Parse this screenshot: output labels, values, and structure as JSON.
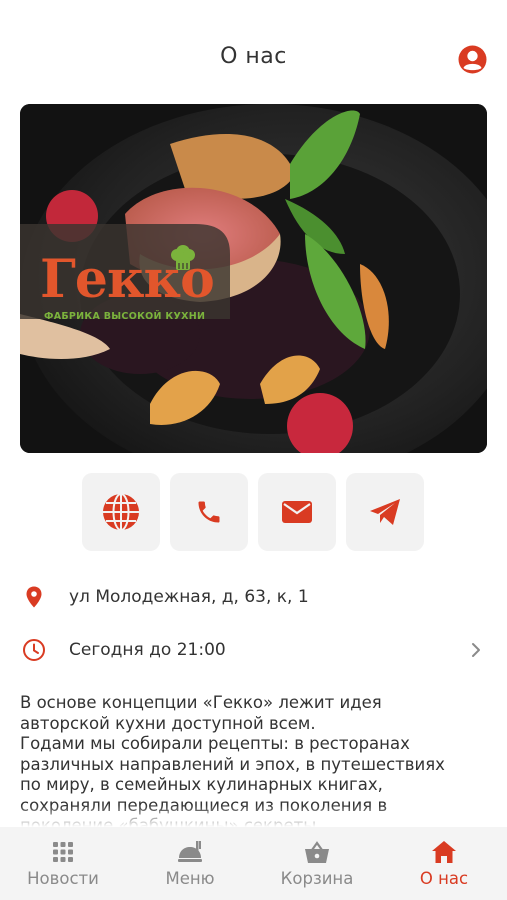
{
  "header": {
    "title": "О нас",
    "profile_icon": "profile-icon"
  },
  "hero": {
    "logo_title": "Гекко",
    "logo_subtitle": "ФАБРИКА ВЫСОКОЙ КУХНИ",
    "chef_hat_icon": "chef-hat-icon"
  },
  "actions": [
    {
      "name": "website",
      "icon": "globe-icon"
    },
    {
      "name": "call",
      "icon": "phone-icon"
    },
    {
      "name": "email",
      "icon": "mail-icon"
    },
    {
      "name": "telegram",
      "icon": "telegram-icon"
    }
  ],
  "info": {
    "address": "ул Молодежная, д, 63, к, 1",
    "hours": "Сегодня до 21:00"
  },
  "about": {
    "text": "В основе концепции «Гекко» лежит идея\nавторской кухни доступной всем.\nГодами мы собирали рецепты: в ресторанах\nразличных направлений и эпох, в путешествиях\nпо миру, в семейных кулинарных книгах,\nсохраняли передающиеся из поколения в\nпоколение «бабушкины» секреты."
  },
  "nav": {
    "items": [
      {
        "label": "Новости",
        "icon": "grid-icon"
      },
      {
        "label": "Меню",
        "icon": "menu-food-icon"
      },
      {
        "label": "Корзина",
        "icon": "basket-icon"
      },
      {
        "label": "О нас",
        "icon": "home-icon"
      }
    ],
    "active_index": 3
  },
  "colors": {
    "accent": "#d93b22",
    "logo_orange": "#e2562c",
    "logo_green": "#7bb33c",
    "inactive": "#8a8a8a"
  }
}
